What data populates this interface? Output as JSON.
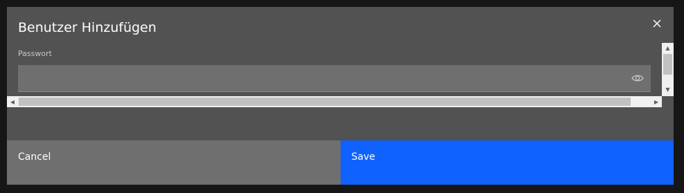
{
  "modal": {
    "title": "Benutzer Hinzufügen",
    "close_icon": "close-icon",
    "password": {
      "label": "Passwort",
      "value": "",
      "placeholder": "",
      "toggle_icon": "eye-icon"
    },
    "buttons": {
      "cancel": "Cancel",
      "save": "Save"
    }
  },
  "colors": {
    "page_bg": "#161616",
    "modal_bg": "#525252",
    "field_bg": "#6f6f6f",
    "cancel_bg": "#6f6f6f",
    "primary": "#0f62fe"
  }
}
